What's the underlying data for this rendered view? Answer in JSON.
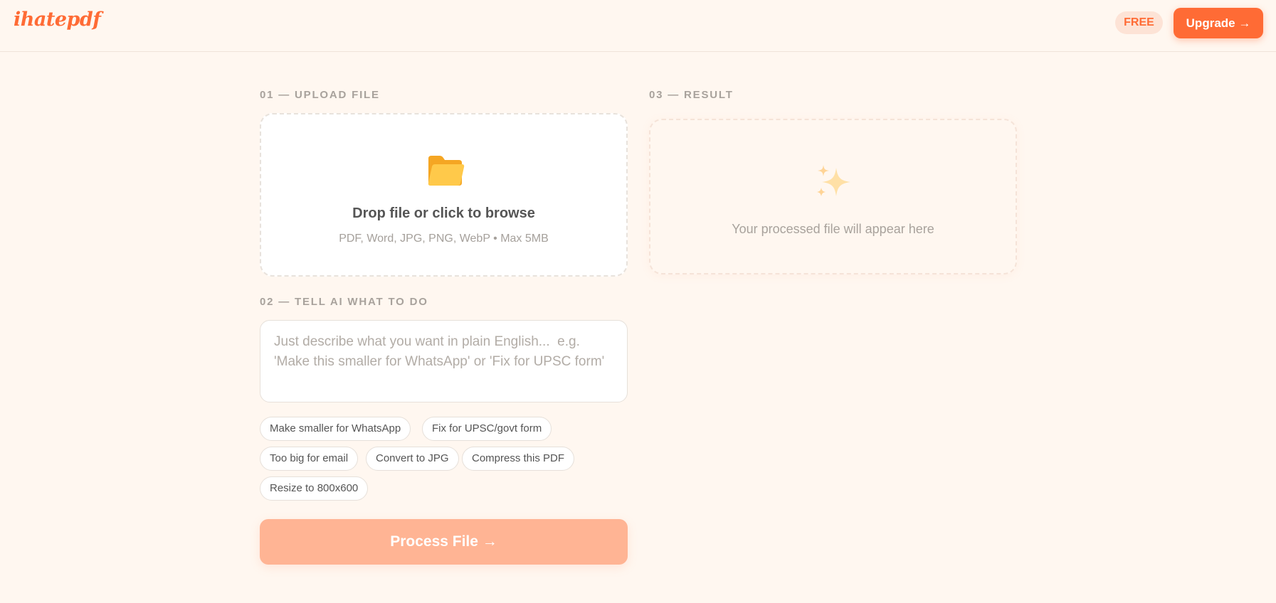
{
  "header": {
    "logo": "ihatepdf",
    "plan_badge": "FREE",
    "upgrade_label": "Upgrade →"
  },
  "upload": {
    "section_label": "01 — UPLOAD FILE",
    "icon": "folder-icon",
    "title": "Drop file or click to browse",
    "subtitle": "PDF, Word, JPG, PNG, WebP • Max 5MB"
  },
  "instruction": {
    "section_label": "02 — TELL AI WHAT TO DO",
    "placeholder": "Just describe what you want in plain English...  e.g. 'Make this smaller for WhatsApp' or 'Fix for UPSC form'",
    "value": "",
    "chips": [
      "Make smaller for WhatsApp",
      "Fix for UPSC/govt form",
      "Too big for email",
      "Convert to JPG",
      "Compress this PDF",
      "Resize to 800x600"
    ]
  },
  "process_button": {
    "label": "Process File →"
  },
  "result": {
    "section_label": "03 — RESULT",
    "icon": "sparkles-icon",
    "placeholder_text": "Your processed file will appear here"
  },
  "colors": {
    "accent": "#ff6b35",
    "background": "#fff7f0",
    "process_disabled": "#ffb494"
  }
}
